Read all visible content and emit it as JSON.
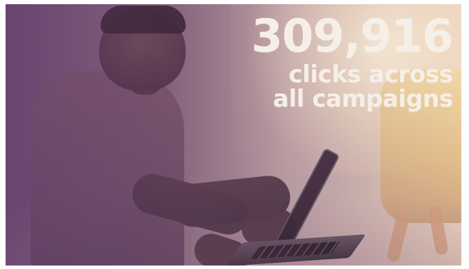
{
  "hero": {
    "stat_value": "309,916",
    "stat_caption": "clicks across\nall campaigns"
  },
  "style": {
    "text_color": "#f5efe8",
    "overlay_color": "#7f5c83"
  }
}
